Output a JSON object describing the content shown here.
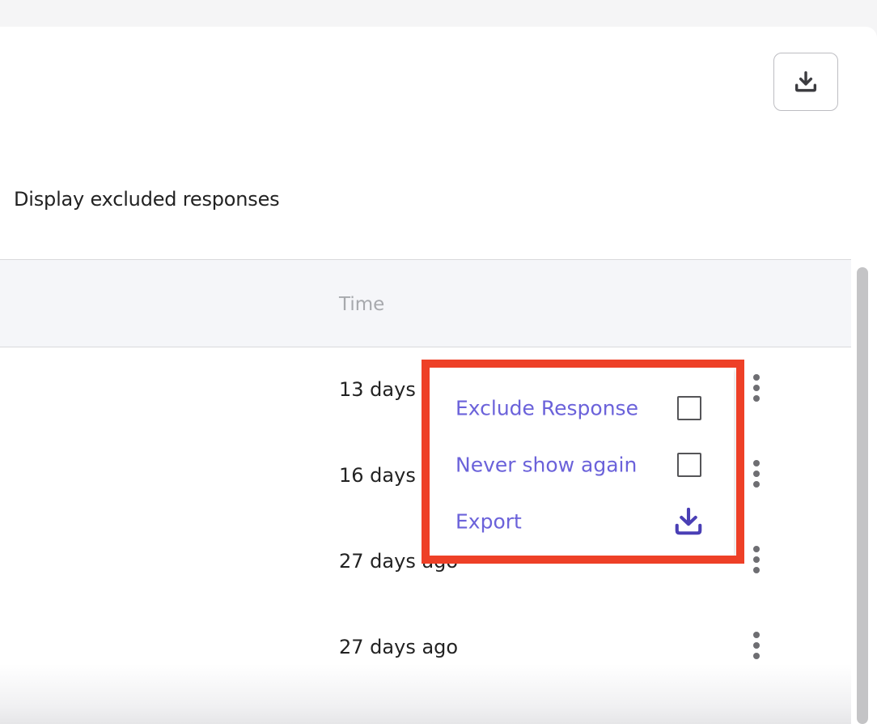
{
  "filters": {
    "excluded_toggle_label": "Display excluded responses"
  },
  "table": {
    "columns": {
      "time": "Time"
    },
    "rows": [
      {
        "time": "13 days ago"
      },
      {
        "time": "16 days ago"
      },
      {
        "time": "27 days ago"
      },
      {
        "time": "27 days ago"
      }
    ]
  },
  "context_menu": {
    "items": [
      {
        "label": "Exclude Response",
        "control": "checkbox",
        "checked": false
      },
      {
        "label": "Never show again",
        "control": "checkbox",
        "checked": false
      },
      {
        "label": "Export",
        "control": "download-icon"
      }
    ]
  },
  "icons": {
    "header_export": "download-icon",
    "row_menu": "kebab-menu-icon"
  },
  "colors": {
    "menu_text": "#6b62da",
    "menu_icon": "#4a3fb5",
    "highlight": "#ee4027",
    "header_bg": "#f5f6f9",
    "muted_text": "#a7a9ad"
  }
}
